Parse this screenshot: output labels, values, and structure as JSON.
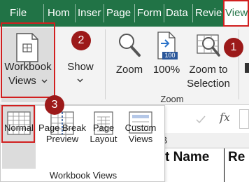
{
  "tabs": [
    {
      "label": "File"
    },
    {
      "label": "Hom"
    },
    {
      "label": "Insert"
    },
    {
      "label": "Page"
    },
    {
      "label": "Form"
    },
    {
      "label": "Data"
    },
    {
      "label": "Revie"
    },
    {
      "label": "View"
    }
  ],
  "ribbon": {
    "workbook_views": {
      "line1": "Workbook",
      "line2": "Views"
    },
    "show": "Show",
    "zoom": "Zoom",
    "zoom100": "100%",
    "zoom_to_selection": {
      "line1": "Zoom to",
      "line2": "Selection"
    },
    "zoom_group_label": "Zoom",
    "zoom100_icon_text": "100"
  },
  "markers": [
    "1",
    "2",
    "3"
  ],
  "formula_bar": {
    "fx": "fx"
  },
  "sheet": {
    "col_header": "B",
    "cell_text": "t Name",
    "cell_text2": "Re"
  },
  "panel": {
    "items": [
      {
        "line1": "Normal",
        "line2": ""
      },
      {
        "line1": "Page Break",
        "line2": "Preview"
      },
      {
        "line1": "Page",
        "line2": "Layout"
      },
      {
        "line1": "Custom",
        "line2": "Views"
      }
    ],
    "group_label": "Workbook Views"
  },
  "colors": {
    "excel_green": "#217346",
    "highlight": "#d11f1f",
    "marker": "#9c1a1a"
  }
}
